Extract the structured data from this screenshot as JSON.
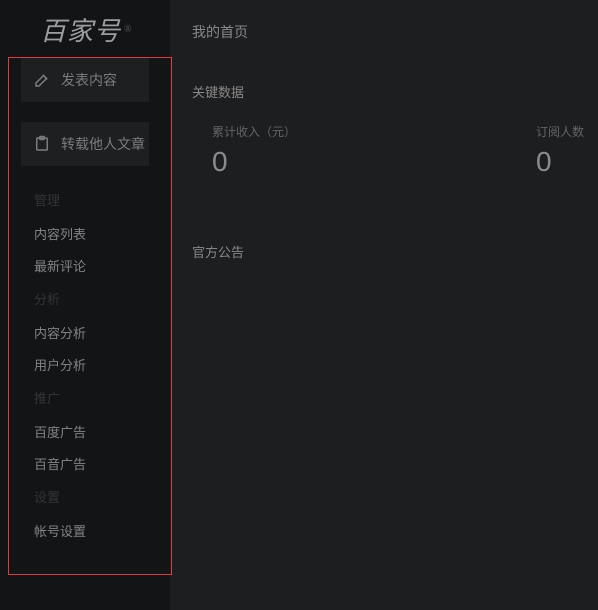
{
  "brand": {
    "logo_text": "百家号"
  },
  "sidebar": {
    "actions": {
      "publish": "发表内容",
      "repost": "转载他人文章"
    },
    "groups": [
      {
        "title": "管理",
        "items": [
          "内容列表",
          "最新评论"
        ]
      },
      {
        "title": "分析",
        "items": [
          "内容分析",
          "用户分析"
        ]
      },
      {
        "title": "推广",
        "items": [
          "百度广告",
          "百音广告"
        ]
      },
      {
        "title": "设置",
        "items": [
          "帐号设置"
        ]
      }
    ]
  },
  "main": {
    "page_title": "我的首页",
    "key_data_title": "关键数据",
    "stats": {
      "income_label": "累计收入（元）",
      "income_value": "0",
      "subs_label": "订阅人数",
      "subs_value": "0"
    },
    "announce_title": "官方公告"
  }
}
